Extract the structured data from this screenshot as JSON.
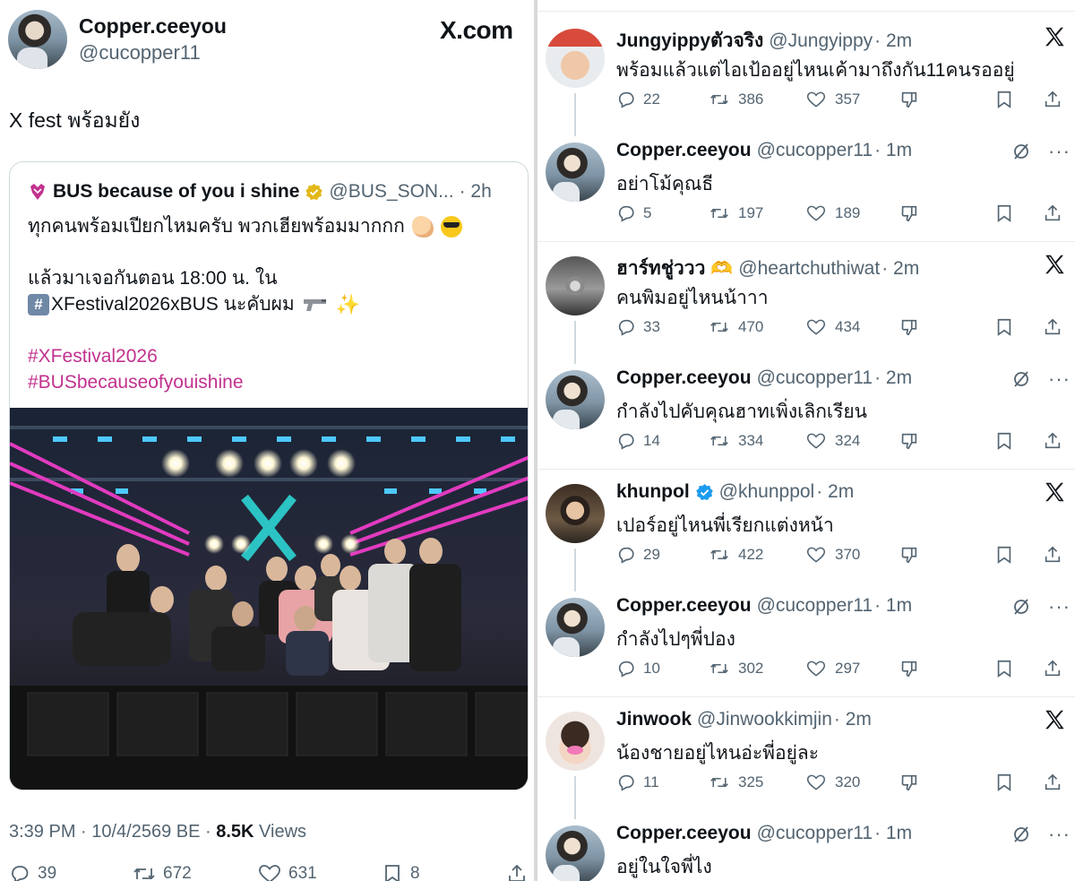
{
  "post": {
    "author_name": "Copper.ceeyou",
    "author_handle": "@cucopper11",
    "site_logo": "X.com",
    "text": "X fest พร้อมยัง",
    "meta_time_date": "3:39 PM · 10/4/2569 BE · ",
    "meta_views_count": "8.5K",
    "meta_views_label": " Views",
    "actions": {
      "replies": "39",
      "reposts": "672",
      "likes": "631",
      "bookmarks": "8"
    }
  },
  "quote": {
    "name": "BUS because of you i shine",
    "handle": "@BUS_SON...",
    "time": "· 2h",
    "line1": "ทุกคนพร้อมเปียกไหมครับ พวกเฮียพร้อมมากกก",
    "line3": "แล้วมาเจอกันตอน 18:00 น. ใน",
    "line4_keycap": "#",
    "line4": "XFestival2026xBUS นะคับผม",
    "hashtag1": "#XFestival2026",
    "hashtag2": "#BUSbecauseofyouishine"
  },
  "replies": [
    {
      "name": "Jungyippyตัวจริง",
      "handle": "@Jungyippy",
      "time": "· 2m",
      "text": "พร้อมแล้วแต่ไอเป้ออยู่ไหนเค้ามาถึงกัน11คนรออยู่",
      "replies": "22",
      "reposts": "386",
      "likes": "357",
      "corner": "x-logo-icon",
      "avatar": "jung"
    },
    {
      "name": "Copper.ceeyou",
      "handle": "@cucopper11",
      "time": "· 1m",
      "text": "อย่าโม้คุณธี",
      "replies": "5",
      "reposts": "197",
      "likes": "189",
      "corner": "grok-and-more",
      "avatar": "copper"
    },
    {
      "name": "ฮาร์ทชู่ววว",
      "handle": "@heartchuthiwat",
      "time": "· 2m",
      "text": "คนพิมอยู่ไหนน้าาา",
      "replies": "33",
      "reposts": "470",
      "likes": "434",
      "corner": "x-logo-icon",
      "avatar": "heart"
    },
    {
      "name": "Copper.ceeyou",
      "handle": "@cucopper11",
      "time": "· 2m",
      "text": "กำลังไปคับคุณฮาทเพิ่งเลิกเรียน",
      "replies": "14",
      "reposts": "334",
      "likes": "324",
      "corner": "grok-and-more",
      "avatar": "copper"
    },
    {
      "name": "khunpol",
      "handle": "@khunppol",
      "time": "· 2m",
      "text": "เปอร์อยู่ไหนพี่เรียกแต่งหน้า",
      "replies": "29",
      "reposts": "422",
      "likes": "370",
      "corner": "x-logo-icon",
      "avatar": "khun"
    },
    {
      "name": "Copper.ceeyou",
      "handle": "@cucopper11",
      "time": "· 1m",
      "text": "กำลังไปๆพี่ปอง",
      "replies": "10",
      "reposts": "302",
      "likes": "297",
      "corner": "grok-and-more",
      "avatar": "copper"
    },
    {
      "name": "Jinwook",
      "handle": "@Jinwookkimjin",
      "time": "· 2m",
      "text": "น้องชายอยู่ไหนอ่ะพี่อยู่ละ",
      "replies": "11",
      "reposts": "325",
      "likes": "320",
      "corner": "x-logo-icon",
      "avatar": "jin"
    },
    {
      "name": "Copper.ceeyou",
      "handle": "@cucopper11",
      "time": "· 1m",
      "text": "อยู่ในใจพี่ไง",
      "replies": "",
      "reposts": "",
      "likes": "",
      "corner": "grok-and-more",
      "avatar": "copper"
    }
  ],
  "colors": {
    "text": "#0f1419",
    "secondary": "#536471",
    "hashtag": "#c2318e",
    "verified_blue": "#1d9bf0",
    "verified_gold": "#e2b719",
    "stage_neon": "#e13bbf"
  }
}
